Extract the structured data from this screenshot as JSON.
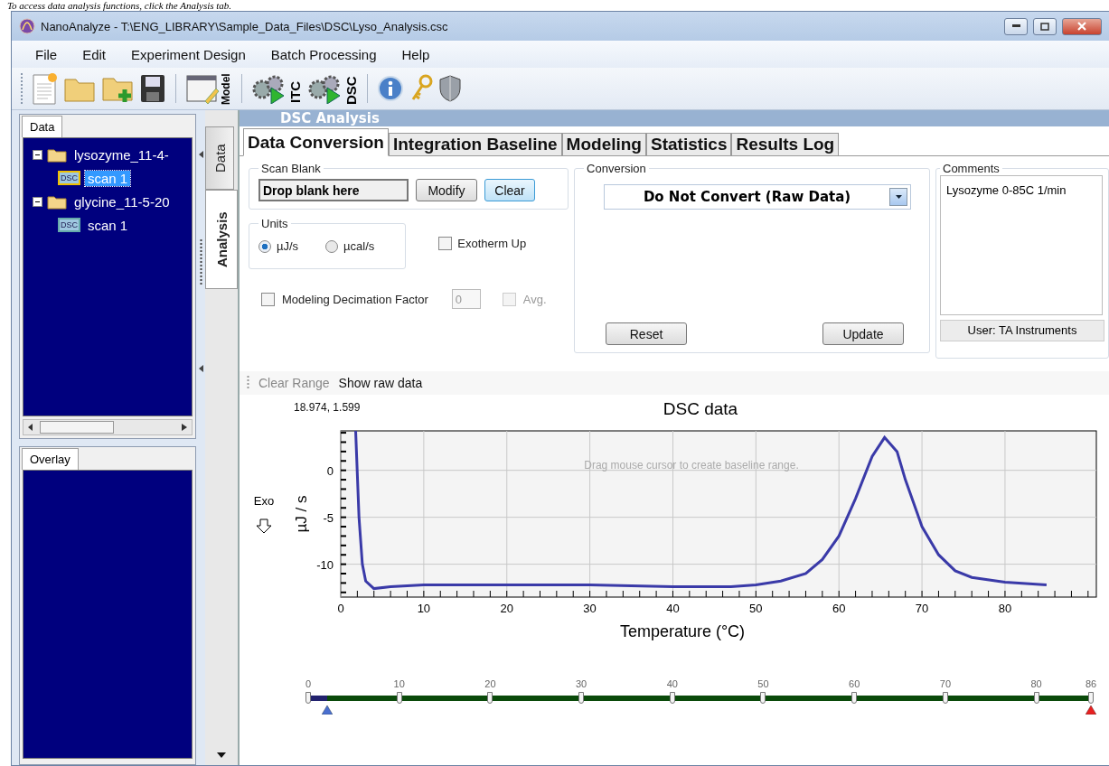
{
  "caption": "To access data analysis functions, click the Analysis tab.",
  "window": {
    "title": "NanoAnalyze - T:\\ENG_LIBRARY\\Sample_Data_Files\\DSC\\Lyso_Analysis.csc"
  },
  "menu": [
    "File",
    "Edit",
    "Experiment Design",
    "Batch Processing",
    "Help"
  ],
  "toolbar": {
    "model_label": "Model",
    "itc_label": "ITC",
    "dsc_label": "DSC"
  },
  "data_panel": {
    "tab": "Data",
    "tree": [
      {
        "label": "lysozyme_11-4-",
        "expanded": true,
        "children": [
          {
            "label": "scan 1",
            "icon_label": "DSC",
            "selected": true
          }
        ]
      },
      {
        "label": "glycine_11-5-20",
        "expanded": true,
        "children": [
          {
            "label": "scan 1",
            "icon_label": "DSC",
            "selected": false
          }
        ]
      }
    ]
  },
  "overlay_panel": {
    "tab": "Overlay"
  },
  "side_tabs": [
    {
      "label": "Data",
      "selected": false
    },
    {
      "label": "Analysis",
      "selected": true
    }
  ],
  "analysis": {
    "header": "DSC Analysis",
    "tabs": [
      {
        "label": "Data Conversion",
        "selected": true
      },
      {
        "label": "Integration Baseline",
        "selected": false
      },
      {
        "label": "Modeling",
        "selected": false
      },
      {
        "label": "Statistics",
        "selected": false
      },
      {
        "label": "Results Log",
        "selected": false
      }
    ],
    "scan_blank": {
      "title": "Scan Blank",
      "value": "Drop blank here",
      "buttons": [
        "Modify",
        "Clear"
      ]
    },
    "units": {
      "title": "Units",
      "options": [
        {
          "label": "µJ/s",
          "selected": true
        },
        {
          "label": "µcal/s",
          "selected": false
        }
      ]
    },
    "exotherm_up": {
      "label": "Exotherm Up",
      "checked": false
    },
    "decimation": {
      "label": "Modeling Decimation Factor",
      "checked": false,
      "value": "0",
      "avg_label": "Avg.",
      "avg_checked": false
    },
    "conversion": {
      "title": "Conversion",
      "value": "Do Not Convert (Raw Data)",
      "buttons": [
        "Reset",
        "Update"
      ]
    },
    "comments": {
      "title": "Comments",
      "text": "Lysozyme 0-85C 1/min",
      "user": "User: TA Instruments"
    },
    "toolstrip": [
      {
        "label": "Clear Range",
        "disabled": true
      },
      {
        "label": "Show raw data",
        "disabled": false
      }
    ],
    "chart": {
      "cursor": "18.974, 1.599",
      "hint": "Drag mouse cursor to create baseline range.",
      "exo_label": "Exo",
      "chart_data": {
        "type": "line",
        "grid": true,
        "title": "DSC data",
        "xlabel": "Temperature (°C)",
        "ylabel": "µJ / s",
        "xlim": [
          0,
          91
        ],
        "ylim": [
          -13.5,
          4.2
        ],
        "xticks": [
          0,
          10,
          20,
          30,
          40,
          50,
          60,
          70,
          80
        ],
        "yticks": [
          -10,
          -5,
          0
        ],
        "x": [
          1.8,
          2.2,
          2.6,
          3,
          4,
          6,
          10,
          20,
          30,
          40,
          47,
          50,
          53,
          56,
          58,
          60,
          62,
          64,
          65.5,
          67,
          68,
          70,
          72,
          74,
          76,
          80,
          85
        ],
        "series": [
          {
            "color": "#3a3aa8",
            "values": [
              4.2,
              -5,
              -10,
              -11.8,
              -12.6,
              -12.4,
              -12.2,
              -12.2,
              -12.2,
              -12.4,
              -12.4,
              -12.2,
              -11.8,
              -11,
              -9.5,
              -7,
              -3,
              1.5,
              3.5,
              2,
              -1,
              -6,
              -9,
              -10.7,
              -11.4,
              -11.9,
              -12.2
            ]
          }
        ]
      }
    },
    "range_slider": {
      "ticks": [
        {
          "label": "0",
          "level": 0
        },
        {
          "label": "10",
          "level": 0.1163
        },
        {
          "label": "20",
          "level": 0.2326
        },
        {
          "label": "30",
          "level": 0.3488
        },
        {
          "label": "40",
          "level": 0.4651
        },
        {
          "label": "50",
          "level": 0.5814
        },
        {
          "label": "60",
          "level": 0.6977
        },
        {
          "label": "70",
          "level": 0.814
        },
        {
          "label": "80",
          "level": 0.9302
        },
        {
          "label": "86",
          "level": 1
        }
      ],
      "handles": [
        {
          "level": 0.024
        },
        {
          "level": 1
        }
      ]
    }
  }
}
